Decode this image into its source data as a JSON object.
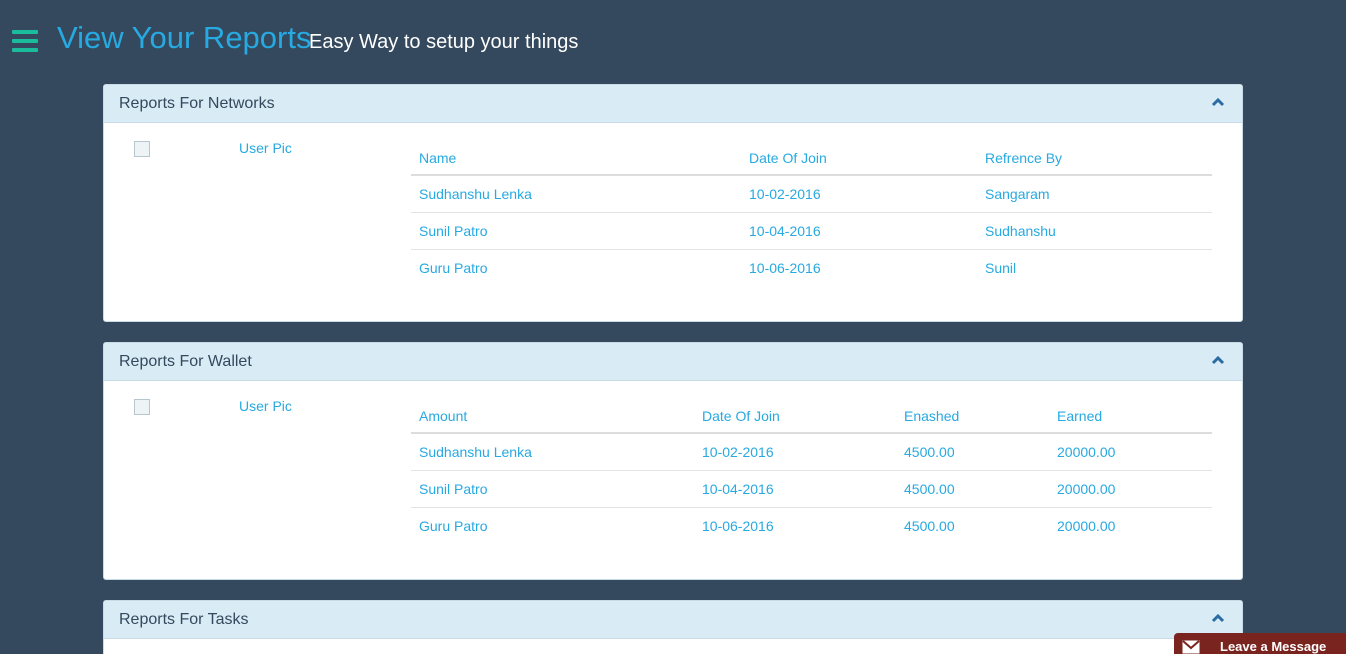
{
  "header": {
    "title": "View Your Reports",
    "subtitle": "Easy Way to setup your things"
  },
  "panels": {
    "networks": {
      "title": "Reports For Networks",
      "user_pic_label": "User Pic",
      "columns": [
        "Name",
        "Date Of Join",
        "Refrence By"
      ],
      "rows": [
        [
          "Sudhanshu Lenka",
          "10-02-2016",
          "Sangaram"
        ],
        [
          "Sunil Patro",
          "10-04-2016",
          "Sudhanshu"
        ],
        [
          "Guru Patro",
          "10-06-2016",
          "Sunil"
        ]
      ]
    },
    "wallet": {
      "title": "Reports For Wallet",
      "user_pic_label": "User Pic",
      "columns": [
        "Amount",
        "Date Of Join",
        "Enashed",
        "Earned"
      ],
      "rows": [
        [
          "Sudhanshu Lenka",
          "10-02-2016",
          "4500.00",
          "20000.00"
        ],
        [
          "Sunil Patro",
          "10-04-2016",
          "4500.00",
          "20000.00"
        ],
        [
          "Guru Patro",
          "10-06-2016",
          "4500.00",
          "20000.00"
        ]
      ]
    },
    "tasks": {
      "title": "Reports For Tasks"
    }
  },
  "chat": {
    "label": "Leave a Message"
  },
  "icons": {
    "menu": "hamburger-menu-icon",
    "collapse": "chevron-up-icon",
    "chat": "envelope-icon"
  },
  "colors": {
    "background": "#34495e",
    "accent": "#27a9e1",
    "menu_icon": "#1abc9c",
    "panel_heading": "#d9ecf5",
    "chat_tab": "#7a2420"
  }
}
